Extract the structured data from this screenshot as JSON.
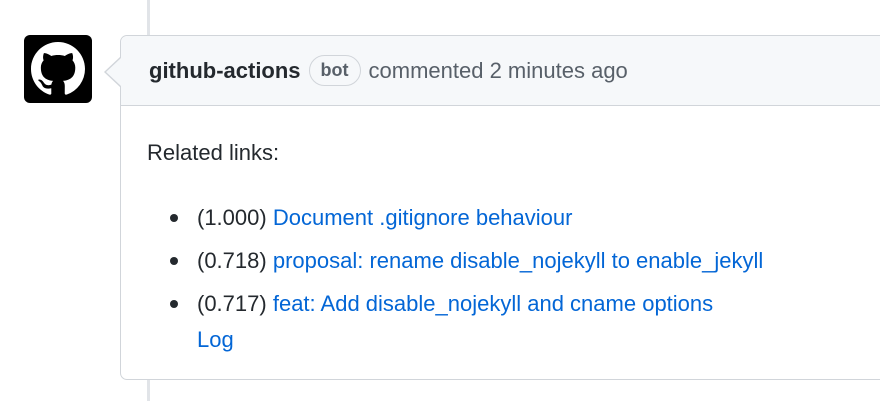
{
  "colors": {
    "link": "#0366d6",
    "text": "#24292e",
    "muted": "#586069",
    "border": "#d1d5da",
    "header_bg": "#f6f8fa",
    "avatar_bg": "#000000"
  },
  "avatar": {
    "icon": "github-mark-icon"
  },
  "comment": {
    "author": "github-actions",
    "badge": "bot",
    "action_time": "commented 2 minutes ago",
    "intro": "Related links:",
    "links": [
      {
        "score": "(1.000)",
        "title": "Document .gitignore behaviour"
      },
      {
        "score": "(0.718)",
        "title": "proposal: rename disable_nojekyll to enable_jekyll"
      },
      {
        "score": "(0.717)",
        "title": "feat: Add disable_nojekyll and cname options",
        "title_cont": "Log"
      }
    ]
  }
}
